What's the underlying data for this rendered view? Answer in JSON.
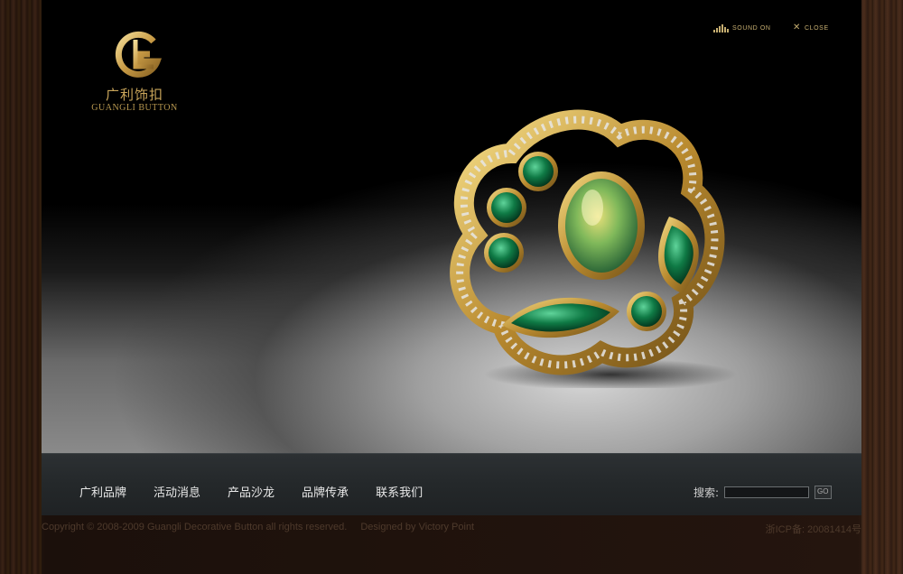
{
  "brand": {
    "name_cn": "广利饰扣",
    "name_en": "GUANGLI BUTTON",
    "logo_glyph": "GL",
    "gold": "#c9a55a"
  },
  "controls": {
    "sound_label": "SOUND ON",
    "close_label": "CLOSE",
    "sound_icon": "equalizer-icon",
    "close_icon": "close-icon"
  },
  "hero": {
    "image": "jeweled-brooch-emerald"
  },
  "nav": {
    "items": [
      {
        "label": "广利品牌"
      },
      {
        "label": "活动消息"
      },
      {
        "label": "产品沙龙"
      },
      {
        "label": "品牌传承"
      },
      {
        "label": "联系我们"
      }
    ]
  },
  "search": {
    "label": "搜索:",
    "value": "",
    "button_label": "GO"
  },
  "footer": {
    "copyright": "Copyright © 2008-2009 Guangli Decorative Button all rights reserved.",
    "designer": "Designed by Victory Point",
    "icp": "浙ICP备: 20081414号"
  }
}
